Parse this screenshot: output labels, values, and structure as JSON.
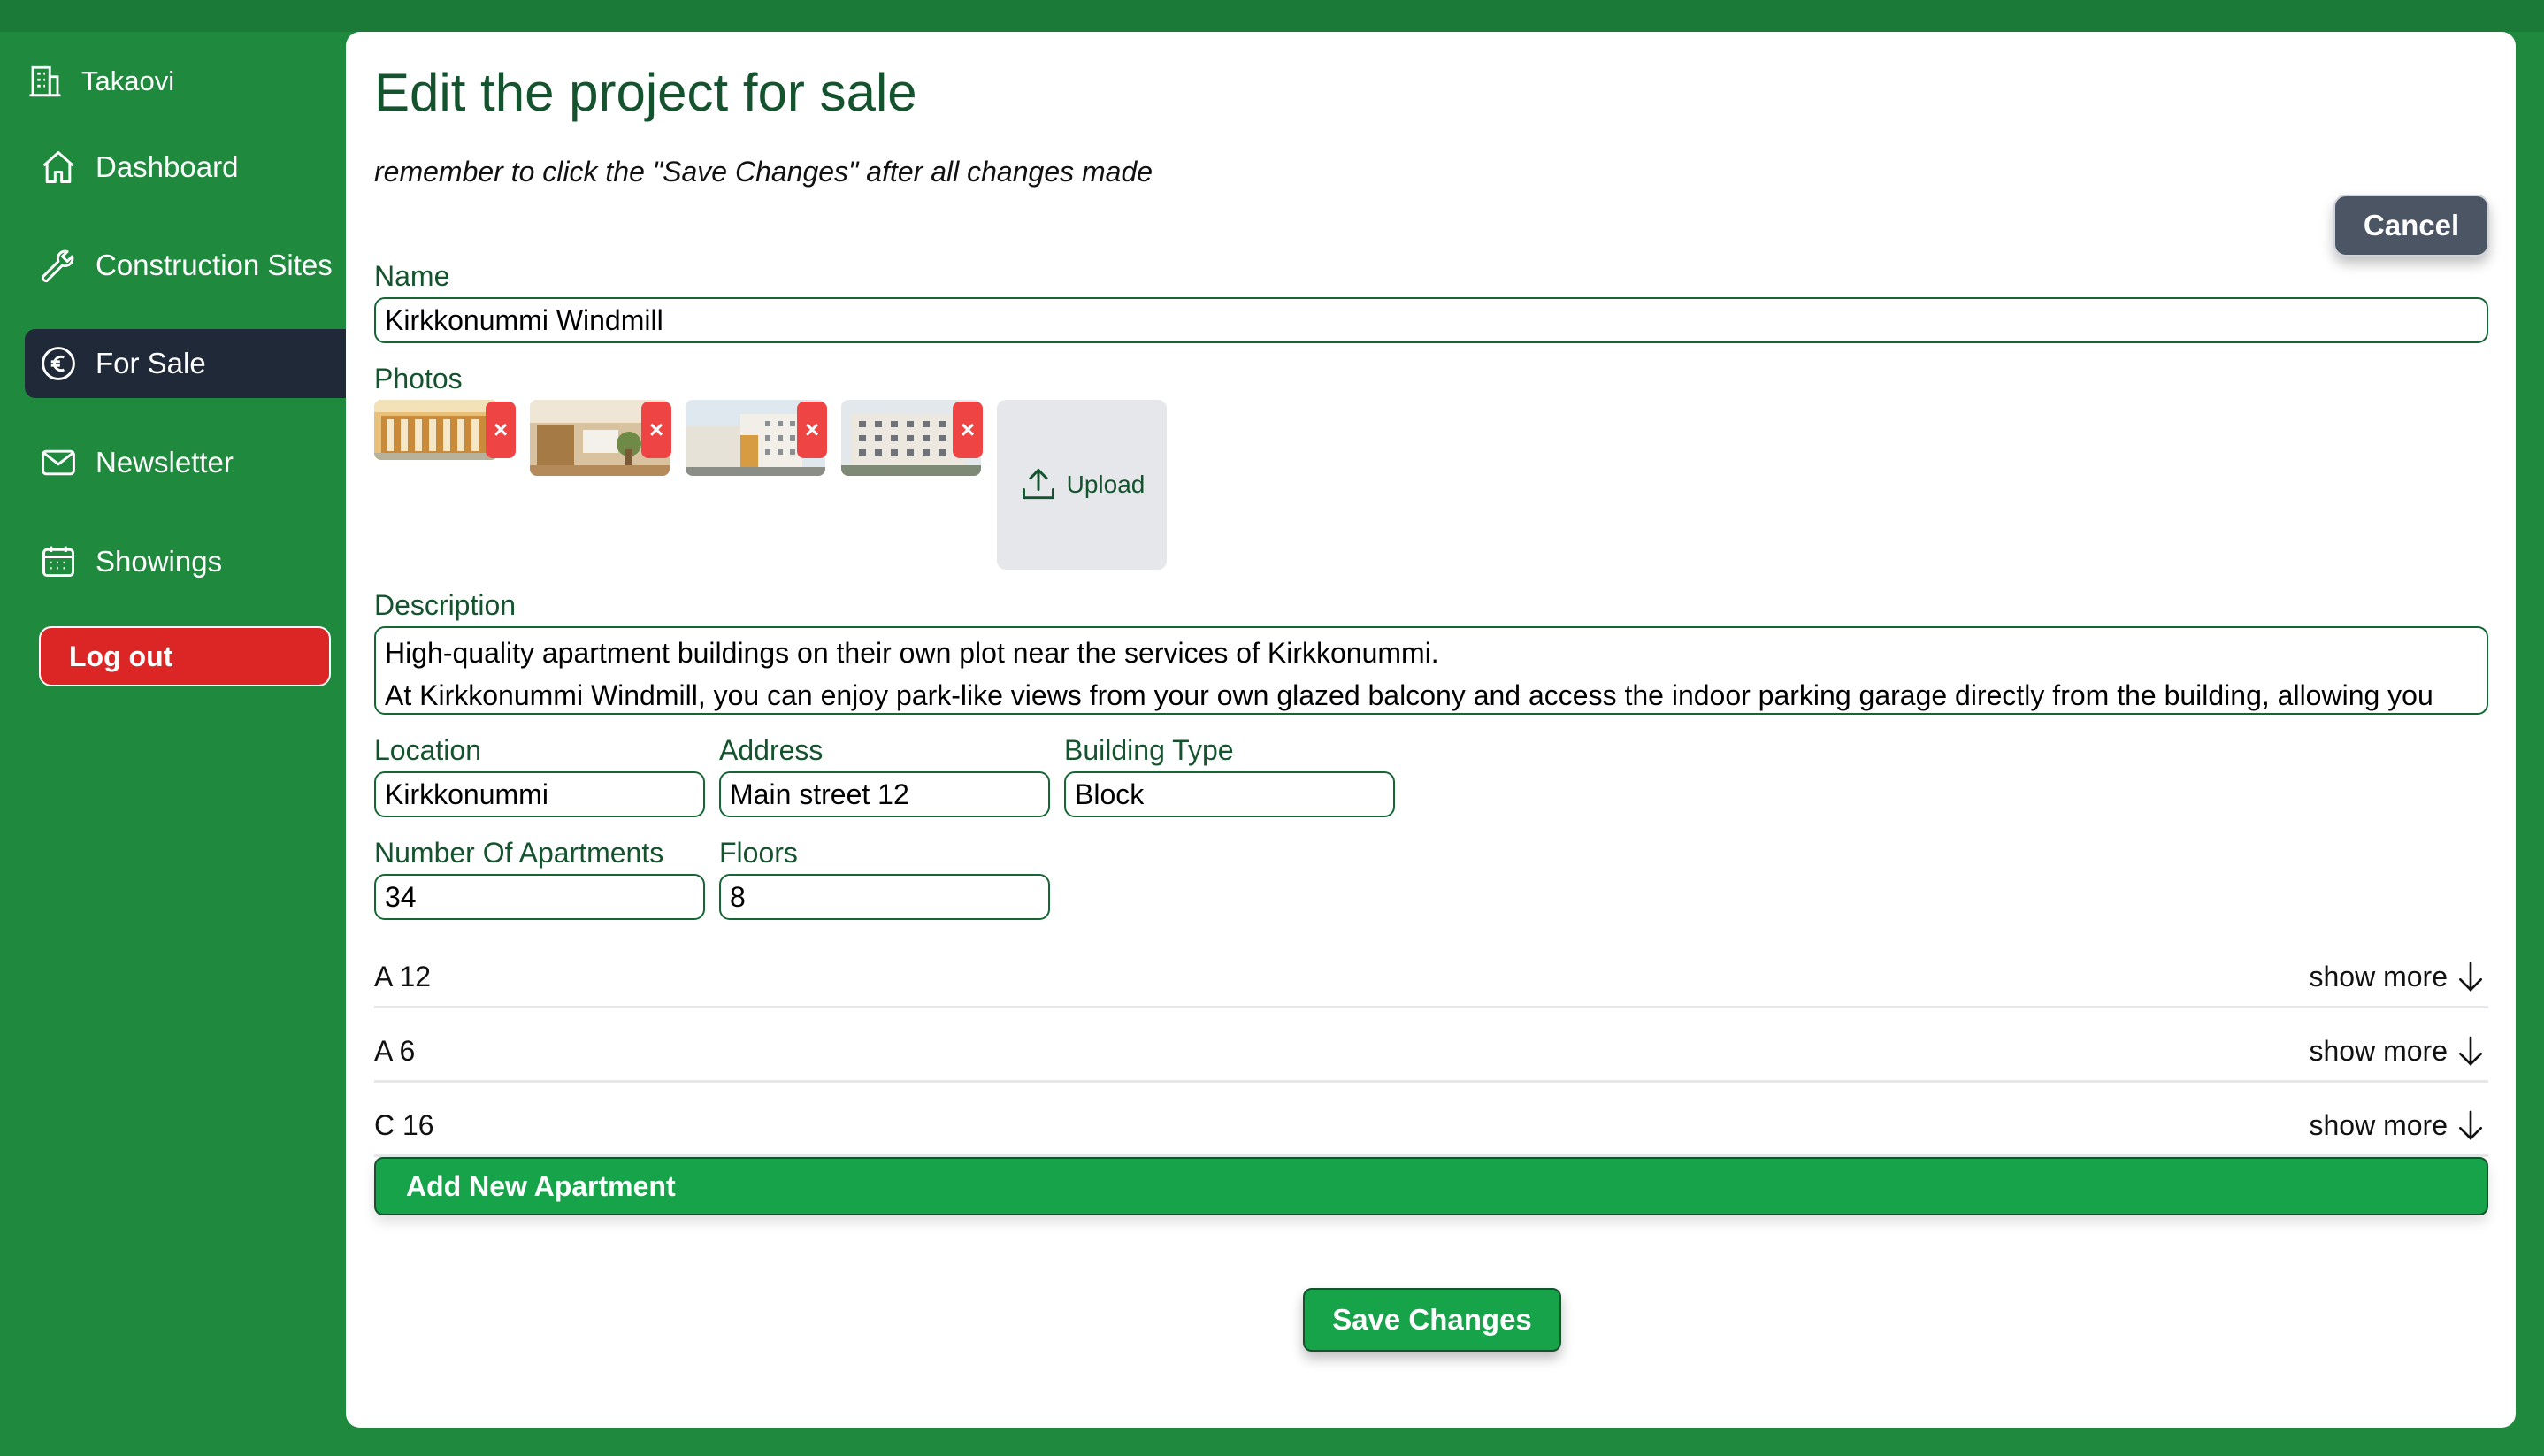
{
  "sidebar": {
    "brand": "Takaovi",
    "items": [
      {
        "label": "Dashboard",
        "icon": "home-icon"
      },
      {
        "label": "Construction Sites",
        "icon": "wrench-icon"
      },
      {
        "label": "For Sale",
        "icon": "euro-icon",
        "active": true
      },
      {
        "label": "Newsletter",
        "icon": "mail-icon"
      },
      {
        "label": "Showings",
        "icon": "calendar-icon"
      }
    ],
    "logout_label": "Log out"
  },
  "page": {
    "title": "Edit the project for sale",
    "hint": "remember to click the \"Save Changes\" after all changes made",
    "cancel_label": "Cancel"
  },
  "form": {
    "name_label": "Name",
    "name_value": "Kirkkonummi Windmill",
    "photos_label": "Photos",
    "photo_remove_label": "×",
    "upload_label": "Upload",
    "description_label": "Description",
    "description_line1": "High-quality apartment buildings on their own plot near the services of Kirkkonummi.",
    "description_line2": "At Kirkkonummi Windmill, you can enjoy park-like views from your own glazed balcony and access the indoor parking garage directly from the building, allowing you",
    "location_label": "Location",
    "location_value": "Kirkkonummi",
    "address_label": "Address",
    "address_value": "Main street 12",
    "building_type_label": "Building Type",
    "building_type_value": "Block",
    "apartments_label": "Number Of Apartments",
    "apartments_value": "34",
    "floors_label": "Floors",
    "floors_value": "8"
  },
  "apartments": [
    {
      "name": "A 12",
      "toggle": "show more"
    },
    {
      "name": "A 6",
      "toggle": "show more"
    },
    {
      "name": "C 16",
      "toggle": "show more"
    }
  ],
  "actions": {
    "add_apartment_label": "Add New Apartment",
    "save_label": "Save Changes"
  },
  "colors": {
    "background": "#1f8a3d",
    "active_nav": "#1f2937",
    "logout": "#dc2626",
    "primary_button": "#16a34a",
    "cancel_button": "#4b5563",
    "heading": "#14532d"
  }
}
